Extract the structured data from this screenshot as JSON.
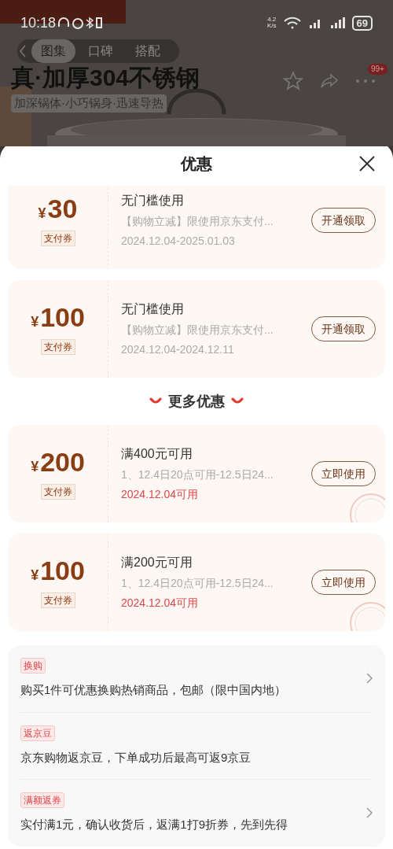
{
  "status_bar": {
    "time": "10:18",
    "speed": "4.2\nK/s",
    "battery": "69"
  },
  "product_header": {
    "title": "真·加厚304不锈钢",
    "subtitle": "加深锅体·小巧锅身·迅速导热",
    "badge": "99+",
    "tabs": [
      {
        "label": "图集",
        "selected": true
      },
      {
        "label": "口碑",
        "selected": false
      },
      {
        "label": "搭配",
        "selected": false
      }
    ]
  },
  "sheet": {
    "title": "优惠",
    "coupons": [
      {
        "currency": "¥",
        "amount": "30",
        "tag": "支付券",
        "title": "无门槛使用",
        "desc": "【购物立减】限使用京东支付...",
        "date": "2024.12.04-2025.01.03",
        "date_highlight": false,
        "button": "开通领取",
        "stamped": false
      },
      {
        "currency": "¥",
        "amount": "100",
        "tag": "支付券",
        "title": "无门槛使用",
        "desc": "【购物立减】限使用京东支付...",
        "date": "2024.12.04-2024.12.11",
        "date_highlight": false,
        "button": "开通领取",
        "stamped": false
      }
    ],
    "more_title": "更多优惠",
    "more_coupons": [
      {
        "currency": "¥",
        "amount": "200",
        "tag": "支付券",
        "title": "满400元可用",
        "desc": "1、12.4日20点可用-12.5日24...",
        "date": "2024.12.04可用",
        "date_highlight": true,
        "button": "立即使用",
        "stamped": true
      },
      {
        "currency": "¥",
        "amount": "100",
        "tag": "支付券",
        "title": "满200元可用",
        "desc": "1、12.4日20点可用-12.5日24...",
        "date": "2024.12.04可用",
        "date_highlight": true,
        "button": "立即使用",
        "stamped": true
      }
    ],
    "promotions": [
      {
        "tag": "换购",
        "text": "购买1件可优惠换购热销商品，包邮（限中国内地）",
        "arrow": true
      },
      {
        "tag": "返京豆",
        "text": "京东购物返京豆，下单成功后最高可返9京豆",
        "arrow": false
      },
      {
        "tag": "满额返券",
        "text": "实付满1元，确认收货后，返满1打9折券，先到先得",
        "arrow": true
      }
    ]
  }
}
